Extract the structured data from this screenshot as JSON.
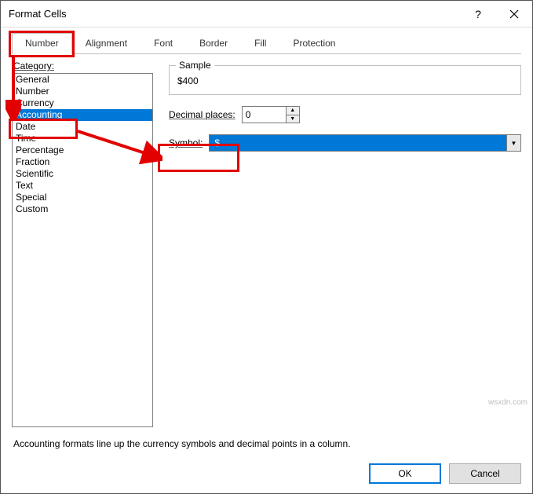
{
  "window": {
    "title": "Format Cells"
  },
  "tabs": [
    "Number",
    "Alignment",
    "Font",
    "Border",
    "Fill",
    "Protection"
  ],
  "active_tab": 0,
  "category": {
    "label": "Category:",
    "items": [
      "General",
      "Number",
      "Currency",
      "Accounting",
      "Date",
      "Time",
      "Percentage",
      "Fraction",
      "Scientific",
      "Text",
      "Special",
      "Custom"
    ],
    "selected_index": 3
  },
  "sample": {
    "label": "Sample",
    "value": "$400"
  },
  "decimal": {
    "label": "Decimal places:",
    "value": "0"
  },
  "symbol": {
    "label": "Symbol:",
    "value": "$"
  },
  "description": "Accounting formats line up the currency symbols and decimal points in a column.",
  "buttons": {
    "ok": "OK",
    "cancel": "Cancel"
  },
  "watermark": "wsxdn.com"
}
